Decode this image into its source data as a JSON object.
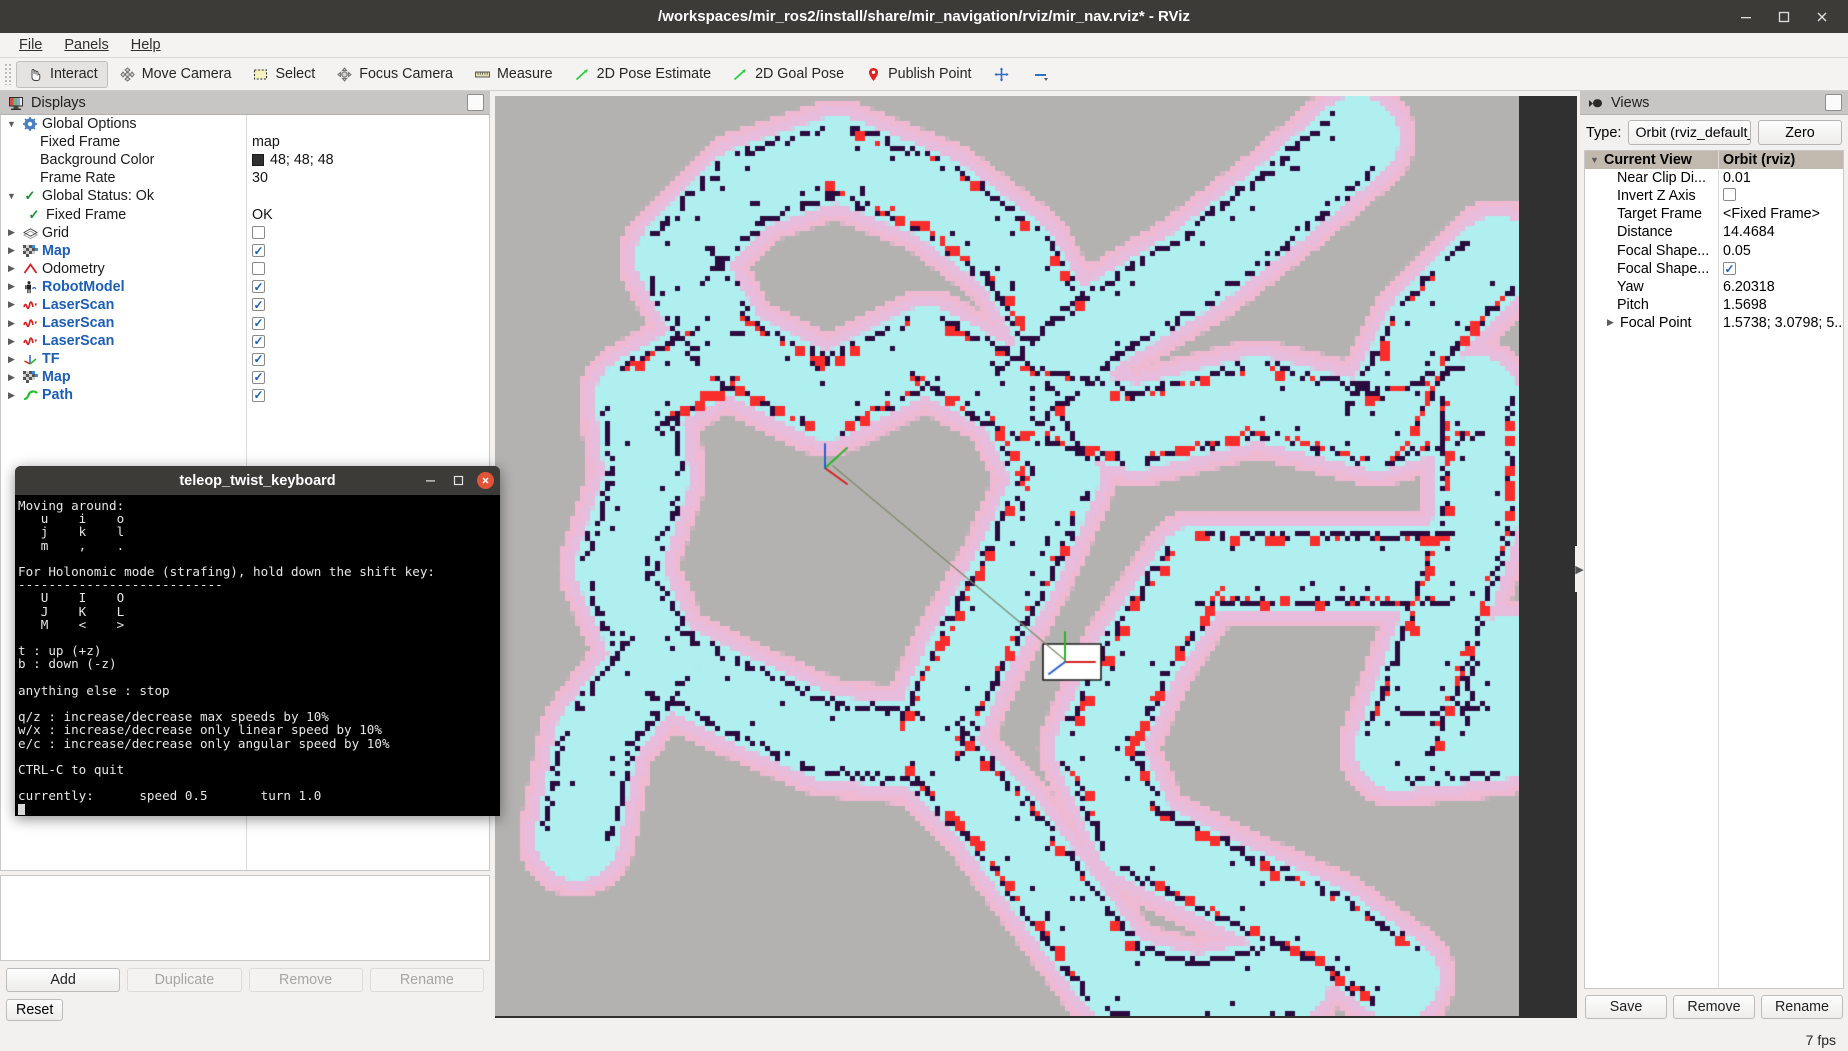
{
  "window": {
    "title": "/workspaces/mir_ros2/install/share/mir_navigation/rviz/mir_nav.rviz* - RViz",
    "minimize_label": "–",
    "maximize_label": "☐",
    "close_label": "✕"
  },
  "menubar": {
    "items": [
      "File",
      "Panels",
      "Help"
    ]
  },
  "toolbar": {
    "items": [
      {
        "label": "Interact",
        "icon": "cursor-hand-icon",
        "active": true
      },
      {
        "label": "Move Camera",
        "icon": "move-camera-icon",
        "active": false
      },
      {
        "label": "Select",
        "icon": "select-rect-icon",
        "active": false
      },
      {
        "label": "Focus Camera",
        "icon": "focus-camera-icon",
        "active": false
      },
      {
        "label": "Measure",
        "icon": "ruler-icon",
        "active": false
      },
      {
        "label": "2D Pose Estimate",
        "icon": "pose-estimate-arrow-icon",
        "active": false
      },
      {
        "label": "2D Goal Pose",
        "icon": "goal-pose-arrow-icon",
        "active": false
      },
      {
        "label": "Publish Point",
        "icon": "publish-point-pin-icon",
        "active": false
      }
    ],
    "extra_icons": [
      "plus-move-icon",
      "minus-icon"
    ]
  },
  "displays": {
    "panel_title": "Displays",
    "panel_icon": "displays-monitor-icon",
    "rows": [
      {
        "indent": 0,
        "arrow": "open",
        "icon": "gear-icon",
        "label": "Global Options",
        "bold": false,
        "value_type": "none",
        "value": ""
      },
      {
        "indent": 1,
        "arrow": "none",
        "icon": "none",
        "label": "Fixed Frame",
        "bold": false,
        "value_type": "text",
        "value": "map"
      },
      {
        "indent": 1,
        "arrow": "none",
        "icon": "none",
        "label": "Background Color",
        "bold": false,
        "value_type": "color",
        "value": "48; 48; 48",
        "color": "#303030"
      },
      {
        "indent": 1,
        "arrow": "none",
        "icon": "none",
        "label": "Frame Rate",
        "bold": false,
        "value_type": "text",
        "value": "30"
      },
      {
        "indent": 0,
        "arrow": "open",
        "icon": "green-check-icon",
        "label": "Global Status: Ok",
        "bold": false,
        "value_type": "none",
        "value": ""
      },
      {
        "indent": 1,
        "arrow": "none",
        "icon": "green-check-icon",
        "label": "Fixed Frame",
        "bold": false,
        "value_type": "text",
        "value": "OK"
      },
      {
        "indent": 0,
        "arrow": "closed",
        "icon": "grid-icon",
        "label": "Grid",
        "bold": false,
        "value_type": "checkbox",
        "value": "off"
      },
      {
        "indent": 0,
        "arrow": "closed",
        "icon": "map-icon",
        "label": "Map",
        "bold": true,
        "value_type": "checkbox",
        "value": "on"
      },
      {
        "indent": 0,
        "arrow": "closed",
        "icon": "odometry-icon",
        "label": "Odometry",
        "bold": false,
        "value_type": "checkbox",
        "value": "off"
      },
      {
        "indent": 0,
        "arrow": "closed",
        "icon": "robotmodel-icon",
        "label": "RobotModel",
        "bold": true,
        "value_type": "checkbox",
        "value": "on"
      },
      {
        "indent": 0,
        "arrow": "closed",
        "icon": "laserscan-icon",
        "label": "LaserScan",
        "bold": true,
        "value_type": "checkbox",
        "value": "on"
      },
      {
        "indent": 0,
        "arrow": "closed",
        "icon": "laserscan-icon",
        "label": "LaserScan",
        "bold": true,
        "value_type": "checkbox",
        "value": "on"
      },
      {
        "indent": 0,
        "arrow": "closed",
        "icon": "laserscan-icon",
        "label": "LaserScan",
        "bold": true,
        "value_type": "checkbox",
        "value": "on"
      },
      {
        "indent": 0,
        "arrow": "closed",
        "icon": "tf-axes-icon",
        "label": "TF",
        "bold": true,
        "value_type": "checkbox",
        "value": "on"
      },
      {
        "indent": 0,
        "arrow": "closed",
        "icon": "map-icon",
        "label": "Map",
        "bold": true,
        "value_type": "checkbox",
        "value": "on"
      },
      {
        "indent": 0,
        "arrow": "closed",
        "icon": "path-icon",
        "label": "Path",
        "bold": true,
        "value_type": "checkbox",
        "value": "on"
      }
    ],
    "buttons": [
      {
        "label": "Add",
        "enabled": true
      },
      {
        "label": "Duplicate",
        "enabled": false
      },
      {
        "label": "Remove",
        "enabled": false
      },
      {
        "label": "Rename",
        "enabled": false
      }
    ],
    "reset_label": "Reset"
  },
  "views": {
    "panel_title": "Views",
    "panel_icon": "views-camera-icon",
    "type_label": "Type:",
    "type_value": "Orbit (rviz_default_",
    "zero_label": "Zero",
    "header": {
      "name": "Current View",
      "value": "Orbit (rviz)"
    },
    "rows": [
      {
        "label": "Near Clip Di...",
        "value_type": "text",
        "value": "0.01"
      },
      {
        "label": "Invert Z Axis",
        "value_type": "checkbox",
        "value": "off"
      },
      {
        "label": "Target Frame",
        "value_type": "text",
        "value": "<Fixed Frame>"
      },
      {
        "label": "Distance",
        "value_type": "text",
        "value": "14.4684"
      },
      {
        "label": "Focal Shape...",
        "value_type": "text",
        "value": "0.05"
      },
      {
        "label": "Focal Shape...",
        "value_type": "checkbox",
        "value": "on"
      },
      {
        "label": "Yaw",
        "value_type": "text",
        "value": "6.20318"
      },
      {
        "label": "Pitch",
        "value_type": "text",
        "value": "1.5698"
      },
      {
        "label": "Focal Point",
        "value_type": "text",
        "value": "1.5738; 3.0798; 5....",
        "arrow": "closed"
      }
    ],
    "buttons": [
      "Save",
      "Remove",
      "Rename"
    ]
  },
  "terminal": {
    "title": "teleop_twist_keyboard",
    "minimize_label": "–",
    "maximize_label": "☐",
    "close_label": "✕",
    "content": "Moving around:\n   u    i    o\n   j    k    l\n   m    ,    .\n\nFor Holonomic mode (strafing), hold down the shift key:\n---------------------------\n   U    I    O\n   J    K    L\n   M    <    >\n\nt : up (+z)\nb : down (-z)\n\nanything else : stop\n\nq/z : increase/decrease max speeds by 10%\nw/x : increase/decrease only linear speed by 10%\ne/c : increase/decrease only angular speed by 10%\n\nCTRL-C to quit\n\ncurrently:\tspeed 0.5\tturn 1.0\n"
  },
  "statusbar": {
    "fps": "7 fps"
  },
  "colors": {
    "map_free": "#b3b2b1",
    "map_inflation_outer": "#f0b9d2",
    "map_inflation_inner": "#afeff0",
    "map_obstacle": "#2b0a3d",
    "map_laser": "#fa2d2d",
    "accent_blue": "#1d5fb4",
    "titlebar": "#3c3b37"
  },
  "viewport": {
    "left_collapse": "◀",
    "right_collapse": "▶"
  }
}
